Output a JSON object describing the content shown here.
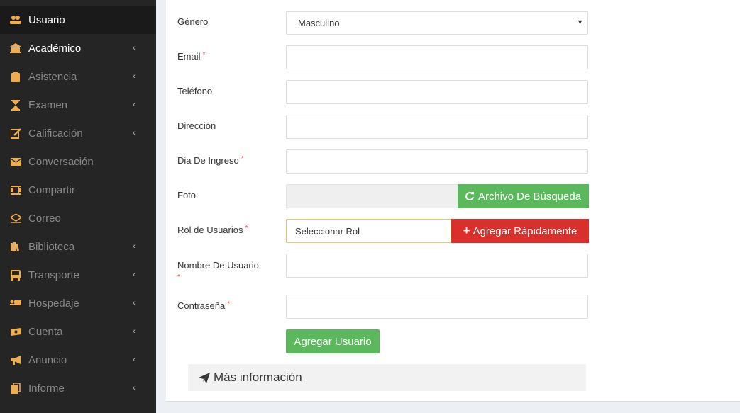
{
  "sidebar": {
    "items": [
      {
        "label": "Usuario",
        "icon": "users-icon",
        "has_submenu": false
      },
      {
        "label": "Académico",
        "icon": "university-icon",
        "has_submenu": true
      },
      {
        "label": "Asistencia",
        "icon": "clipboard-icon",
        "has_submenu": true
      },
      {
        "label": "Examen",
        "icon": "hourglass-icon",
        "has_submenu": true
      },
      {
        "label": "Calificación",
        "icon": "edit-icon",
        "has_submenu": true
      },
      {
        "label": "Conversación",
        "icon": "envelope-icon",
        "has_submenu": false
      },
      {
        "label": "Compartir",
        "icon": "film-icon",
        "has_submenu": false
      },
      {
        "label": "Correo",
        "icon": "envelope-open-icon",
        "has_submenu": false
      },
      {
        "label": "Biblioteca",
        "icon": "books-icon",
        "has_submenu": true
      },
      {
        "label": "Transporte",
        "icon": "bus-icon",
        "has_submenu": true
      },
      {
        "label": "Hospedaje",
        "icon": "bed-icon",
        "has_submenu": true
      },
      {
        "label": "Cuenta",
        "icon": "money-icon",
        "has_submenu": true
      },
      {
        "label": "Anuncio",
        "icon": "bullhorn-icon",
        "has_submenu": true
      },
      {
        "label": "Informe",
        "icon": "file-icon",
        "has_submenu": true
      }
    ],
    "chevron": "‹"
  },
  "form": {
    "genero_label": "Género",
    "genero_value": "Masculino",
    "email_label": "Email",
    "telefono_label": "Teléfono",
    "direccion_label": "Dirección",
    "ingreso_label": "Dia De Ingreso",
    "foto_label": "Foto",
    "archivo_button": "Archivo De Búsqueda",
    "rol_label": "Rol de Usuarios",
    "rol_value": "Seleccionar Rol",
    "agregar_rapido_button": "Agregar Rápidamente",
    "usuario_label": "Nombre De Usuario",
    "password_label": "Contraseña",
    "required_mark": "*",
    "submit_button": "Agregar Usuario"
  },
  "info": {
    "label": "Más información"
  },
  "colors": {
    "accent_yellow": "#f0ad4e",
    "success": "#5cb85c",
    "danger": "#d9302c"
  }
}
